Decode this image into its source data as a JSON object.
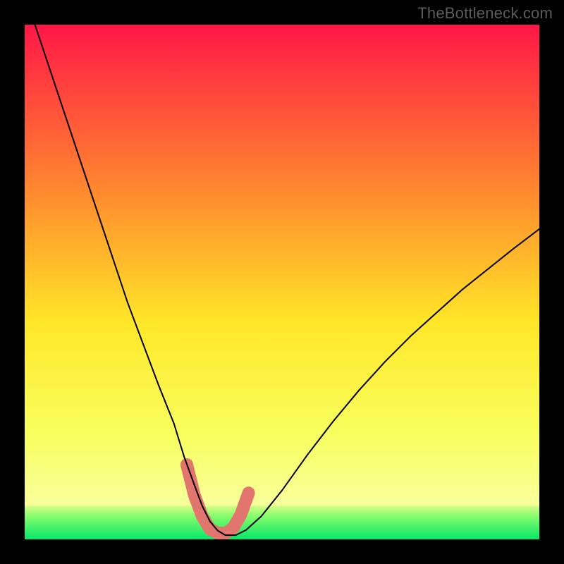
{
  "watermark": "TheBottleneck.com",
  "chart_data": {
    "type": "line",
    "title": "",
    "xlabel": "",
    "ylabel": "",
    "xlim": [
      0,
      100
    ],
    "ylim": [
      0,
      100
    ],
    "grid": false,
    "legend": false,
    "background_gradient": {
      "top": "#ff1747",
      "mid_upper": "#ff8b2e",
      "mid": "#ffe728",
      "mid_lower": "#f8ff60",
      "green_band": "#9dff6b",
      "bottom": "#07e76a"
    },
    "series": [
      {
        "name": "bottleneck-curve",
        "x": [
          2,
          5,
          8,
          11,
          14,
          17,
          20,
          23,
          26,
          29,
          31,
          33,
          34.5,
          36,
          37.5,
          39,
          41,
          43,
          46,
          50,
          55,
          60,
          65,
          70,
          75,
          80,
          85,
          90,
          95,
          100
        ],
        "y": [
          100,
          91,
          82,
          73,
          64,
          55,
          46,
          38,
          30,
          22.5,
          16,
          10.5,
          6.5,
          3.5,
          1.7,
          0.8,
          0.8,
          1.8,
          4.5,
          9.5,
          16.5,
          23,
          29,
          34.5,
          39.5,
          44,
          48.5,
          52.5,
          56.5,
          60.3
        ],
        "stroke": "#000000",
        "stroke_width": 2
      },
      {
        "name": "highlight-valley",
        "x": [
          31.5,
          33,
          34.5,
          36,
          37.5,
          39,
          40.5,
          42,
          43.5
        ],
        "y": [
          14.5,
          8.5,
          4.5,
          2,
          1.2,
          1.2,
          2.2,
          4.8,
          9
        ],
        "stroke": "#e2766f",
        "stroke_width": 18,
        "linecap": "round",
        "markers": {
          "indices": [
            0,
            8
          ],
          "radius": 9,
          "fill": "#e2766f"
        }
      }
    ],
    "green_band_y": [
      0,
      6.5
    ]
  }
}
